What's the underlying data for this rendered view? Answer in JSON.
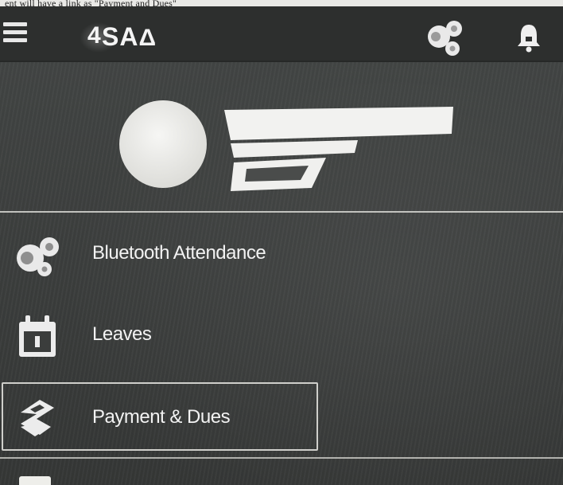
{
  "caption": {
    "text": "ent will have a link as \"Payment and Dues\""
  },
  "header": {
    "logo_text": "SA",
    "icons": [
      "menu-icon",
      "bluetooth-attendance-icon",
      "bell-icon"
    ]
  },
  "nav": {
    "items": [
      {
        "label": "Bluetooth Attendance",
        "icon": "bluetooth-attendance-icon"
      },
      {
        "label": "Leaves",
        "icon": "calendar-icon"
      },
      {
        "label": "Payment & Dues",
        "icon": "payment-icon",
        "selected": true
      }
    ]
  },
  "colors": {
    "appbar": "#2d2f2e",
    "text": "#f2f2f2",
    "background": "#3a3c3b"
  }
}
